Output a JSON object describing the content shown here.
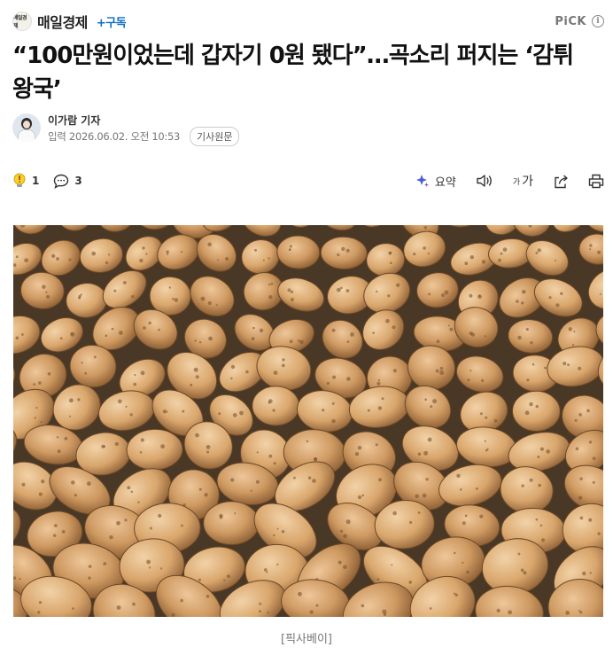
{
  "header": {
    "press_logo_text": "매일경제",
    "press_name": "매일경제",
    "subscribe_label": "+구독",
    "pick_label": "PiCK",
    "info_icon": "info-icon"
  },
  "article": {
    "headline": "“100만원이었는데 갑자기 0원 됐다”…곡소리 퍼지는 ‘감튀 왕국’",
    "reporter": "이가람 기자",
    "input_label": "입력",
    "timestamp": "2026.06.02. 오전 10:53",
    "original_button": "기사원문"
  },
  "toolbar": {
    "reaction_count": "1",
    "reaction_icon": "lightbulb-icon",
    "comment_count": "3",
    "comment_icon": "comment-icon",
    "summary_label": "요약",
    "summary_icon": "sparkle-icon",
    "listen_icon": "speaker-icon",
    "font_size_label": "가",
    "font_size_small": "가",
    "share_icon": "share-icon",
    "print_icon": "print-icon"
  },
  "image": {
    "subject": "pile of potatoes",
    "caption": "[픽사베이]"
  }
}
